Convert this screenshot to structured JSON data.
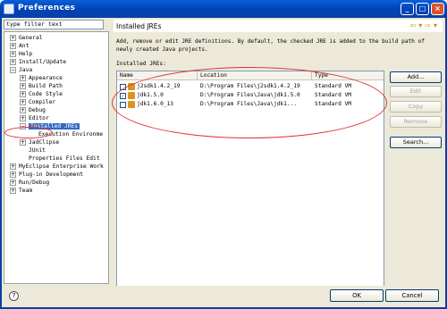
{
  "window": {
    "title": "Preferences",
    "controls": [
      "_",
      "□",
      "×"
    ]
  },
  "filter": {
    "value": "type filter text"
  },
  "tree": [
    {
      "label": "General",
      "toggle": "+"
    },
    {
      "label": "Ant",
      "toggle": "+"
    },
    {
      "label": "Help",
      "toggle": "+"
    },
    {
      "label": "Install/Update",
      "toggle": "+"
    },
    {
      "label": "Java",
      "toggle": "−"
    },
    {
      "label": "Appearance",
      "toggle": "+"
    },
    {
      "label": "Build Path",
      "toggle": "+"
    },
    {
      "label": "Code Style",
      "toggle": "+"
    },
    {
      "label": "Compiler",
      "toggle": "+"
    },
    {
      "label": "Debug",
      "toggle": "+"
    },
    {
      "label": "Editor",
      "toggle": "+"
    },
    {
      "label": "Installed JREs",
      "toggle": "−"
    },
    {
      "label": "Execution Environme",
      "toggle": ""
    },
    {
      "label": "JadClipse",
      "toggle": "+"
    },
    {
      "label": "JUnit",
      "toggle": ""
    },
    {
      "label": "Properties Files Edit",
      "toggle": ""
    },
    {
      "label": "MyEclipse Enterprise Work",
      "toggle": "+"
    },
    {
      "label": "Plug-in Development",
      "toggle": "+"
    },
    {
      "label": "Run/Debug",
      "toggle": "+"
    },
    {
      "label": "Team",
      "toggle": "+"
    }
  ],
  "page": {
    "title": "Installed JREs",
    "description": "Add, remove or edit JRE definitions. By default, the checked JRE is added to the build path of newly created Java projects.",
    "table_label": "Installed JREs:",
    "columns": [
      "Name",
      "Location",
      "Type"
    ],
    "rows": [
      {
        "checked": false,
        "name": "j2sdk1.4.2_19",
        "location": "D:\\Program Files\\j2sdk1.4.2_19",
        "type": "Standard VM"
      },
      {
        "checked": true,
        "name": "jdk1.5.0",
        "location": "D:\\Program Files\\Java\\jdk1.5.0",
        "type": "Standard VM"
      },
      {
        "checked": false,
        "name": "jdk1.6.0_13",
        "location": "D:\\Program Files\\Java\\jdk1...",
        "type": "Standard VM"
      }
    ],
    "buttons": {
      "add": "Add...",
      "edit": "Edit",
      "copy": "Copy",
      "remove": "Remove",
      "search": "Search..."
    }
  },
  "footer": {
    "ok": "OK",
    "cancel": "Cancel"
  },
  "colors": {
    "annotation": "#e03030",
    "selection": "#316ac5"
  }
}
